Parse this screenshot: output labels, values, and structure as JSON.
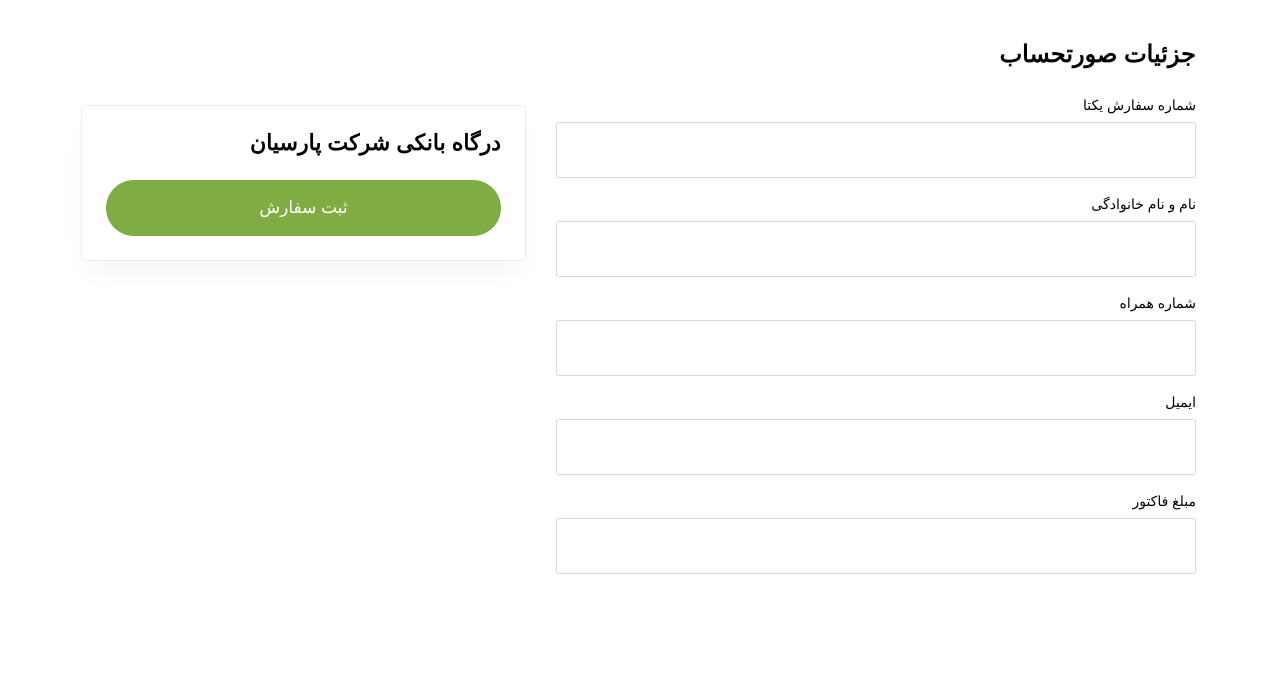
{
  "page": {
    "title": "جزئیات صورتحساب"
  },
  "form": {
    "fields": {
      "order_number": {
        "label": "شماره سفارش یکتا",
        "value": ""
      },
      "full_name": {
        "label": "نام و نام خانوادگی",
        "value": ""
      },
      "mobile": {
        "label": "شماره همراه",
        "value": ""
      },
      "email": {
        "label": "ایمیل",
        "value": ""
      },
      "invoice_amount": {
        "label": "مبلغ فاکتور",
        "value": ""
      }
    }
  },
  "payment": {
    "title": "درگاه بانکی شرکت پارسیان",
    "submit_label": "ثبت سفارش"
  },
  "colors": {
    "button_bg": "#7fac43",
    "border": "#d9d9d9"
  }
}
